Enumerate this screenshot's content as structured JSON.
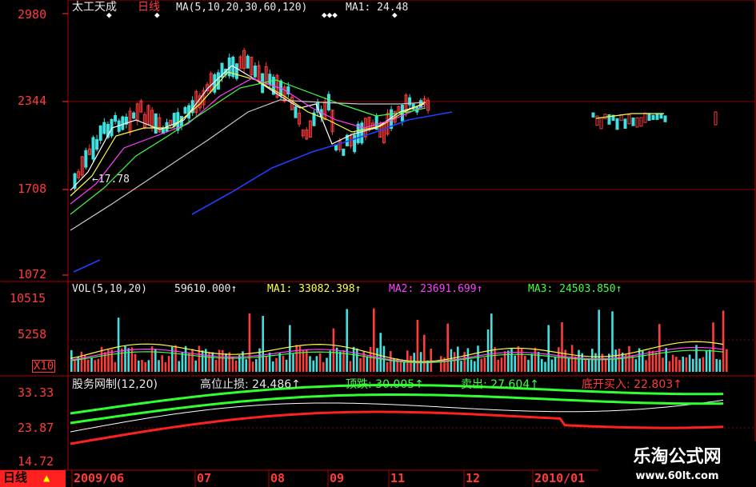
{
  "main": {
    "name": "太工天成",
    "period": "日线",
    "ma_label": "MA(5,10,20,30,60,120)",
    "ma1_label": "MA1: 24.48",
    "y_labels": [
      "2980",
      "2344",
      "1708",
      "1072"
    ],
    "price_range": [
      1072,
      2980
    ],
    "annotation": "←17.78"
  },
  "volume": {
    "header": "VOL(5,10,20)",
    "vol_value": "59610.000↑",
    "ma1": "MA1: 33082.398↑",
    "ma2": "MA2: 23691.699↑",
    "ma3": "MA3: 24503.850↑",
    "y_labels": [
      "10515",
      "5258",
      "X10"
    ],
    "range": [
      0,
      10515
    ]
  },
  "indicator": {
    "name": "股务网制(12,20)",
    "stop_label": "高位止损: 24.486↑",
    "top_label": "顶跌: 30.005↑",
    "sell_label": "卖出: 27.604↑",
    "buy_label": "底开买入: 22.803↑",
    "y_labels": [
      "33.33",
      "23.87",
      "14.72"
    ],
    "range": [
      14.72,
      33.33
    ]
  },
  "xaxis": {
    "tab_label": "日线",
    "dates": [
      "2009/06",
      "07",
      "08",
      "09",
      "11",
      "12",
      "2010/01"
    ]
  },
  "watermark": {
    "name": "乐淘公式网",
    "url": "www.60lt.com"
  },
  "colors": {
    "up": "#ff3b3b",
    "down": "#40e0e0",
    "ma5": "#ffffff",
    "ma10": "#ffff40",
    "ma20": "#ff40ff",
    "ma30": "#40ff40",
    "ma60": "#c8c8c8",
    "ma120": "#2040ff"
  }
}
